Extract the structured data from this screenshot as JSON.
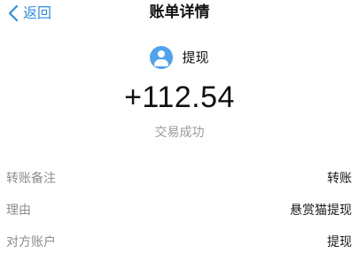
{
  "nav": {
    "back_label": "返回",
    "title": "账单详情"
  },
  "payee": {
    "name": "提现",
    "avatar_icon": "user-avatar-icon",
    "avatar_color": "#4fa3ee"
  },
  "transaction": {
    "amount": "+112.54",
    "status": "交易成功"
  },
  "details": [
    {
      "label": "转账备注",
      "value": "转账"
    },
    {
      "label": "理由",
      "value": "悬赏猫提现"
    },
    {
      "label": "对方账户",
      "value": "提现"
    }
  ],
  "colors": {
    "accent": "#2f8ee8",
    "muted_text": "#9b9b9b"
  }
}
